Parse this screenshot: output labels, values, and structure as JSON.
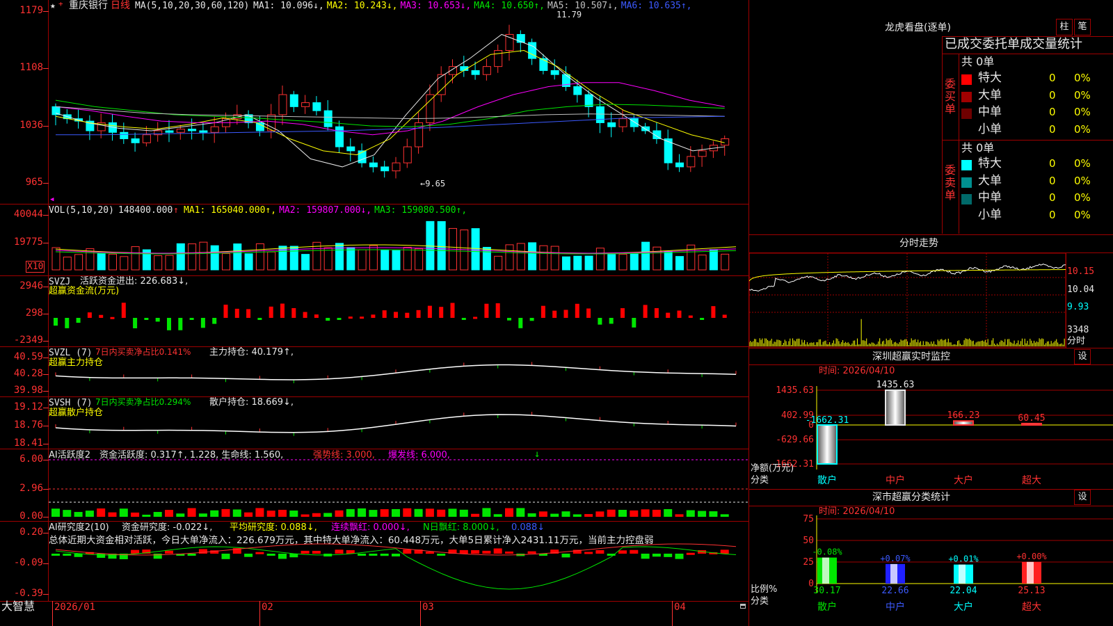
{
  "stock": {
    "name": "重庆银行",
    "period": "日线"
  },
  "main_chart": {
    "ma_label": "MA(5,10,20,30,60,120)",
    "ma_values": [
      {
        "label": "MA1:",
        "value": "10.096",
        "arrow": "↓",
        "color": "#e8e8e8"
      },
      {
        "label": "MA2:",
        "value": "10.243",
        "arrow": "↓",
        "color": "#ffff00"
      },
      {
        "label": "MA3:",
        "value": "10.653",
        "arrow": "↓",
        "color": "#ff00ff"
      },
      {
        "label": "MA4:",
        "value": "10.650",
        "arrow": "↑",
        "color": "#00e600"
      },
      {
        "label": "MA5:",
        "value": "10.507",
        "arrow": "↓",
        "color": "#c0c0c0"
      },
      {
        "label": "MA6:",
        "value": "10.635",
        "arrow": "↑",
        "color": "#3c5aff"
      }
    ],
    "y_ticks": [
      "1179",
      "1108",
      "1036",
      "965"
    ],
    "high_label": "11.79",
    "low_label": "←9.65"
  },
  "volume": {
    "label": "VOL(5,10,20)",
    "value": "148400.000",
    "ma": [
      {
        "label": "MA1:",
        "value": "165040.000",
        "arrow": "↑",
        "color": "#ffff00"
      },
      {
        "label": "MA2:",
        "value": "159807.000",
        "arrow": "↓",
        "color": "#ff00ff"
      },
      {
        "label": "MA3:",
        "value": "159080.500",
        "arrow": "↑",
        "color": "#00e600"
      }
    ],
    "y_ticks": [
      "40044",
      "19775"
    ],
    "unit": "X10"
  },
  "svzj": {
    "label": "SVZJ",
    "line1": "活跃资金进出: 226.683↓,",
    "line2": "超赢资金流(万元)",
    "y_ticks": [
      "2946",
      "298",
      "-2349"
    ]
  },
  "svzl": {
    "label": "SVZL (7)",
    "ratio": "7日内买卖净占比0.141%",
    "hold": "主力持仓: 40.179↑,",
    "line2": "超赢主力持仓",
    "y_ticks": [
      "40.59",
      "40.28",
      "39.98"
    ]
  },
  "svsh": {
    "label": "SVSH (7)",
    "ratio": "7日内买卖净占比0.294%",
    "hold": "散户持仓: 18.669↓,",
    "line2": "超赢散户持仓",
    "y_ticks": [
      "19.12",
      "18.76",
      "18.41"
    ]
  },
  "ai_active": {
    "name": "AI活跃度2",
    "text_a": "资金活跃度: 0.317↑, 1.228, 生命线: 1.560,",
    "strong": "强势线: 3.000,",
    "burst": "爆发线: 6.000,",
    "y_ticks": [
      "6.00",
      "2.96",
      "0.00"
    ]
  },
  "ai_research": {
    "name": "AI研究度2(10)",
    "a": "资金研究度: -0.022↓,",
    "b": "平均研究度: 0.088↓,",
    "c": "连续飘红: 0.000↓,",
    "d": "N日飘红: 8.000↓,",
    "e": "0.088↓",
    "summary": "总体近期大资金相对活跃，今日大单净流入：226.679万元，其中特大单净流入：60.448万元，大单5日累计净入2431.11万元，当前主力控盘弱",
    "y_ticks": [
      "0.20",
      "-0.09",
      "-0.39"
    ]
  },
  "x_axis": {
    "brand": "大智慧",
    "dates": [
      "2026/01",
      "02",
      "03",
      "04"
    ]
  },
  "dragon": {
    "title": "龙虎看盘(逐单)",
    "btn_bar": "柱",
    "btn_pen": "笔",
    "heading": "已成交委托单成交量统计",
    "buy_label": "委买单",
    "sell_label": "委卖单",
    "buy_total": "共 0单",
    "sell_total": "共 0单",
    "buy_rows": [
      {
        "name": "特大",
        "count": "0",
        "pct": "0%",
        "color": "#ff0000"
      },
      {
        "name": "大单",
        "count": "0",
        "pct": "0%",
        "color": "#a00000"
      },
      {
        "name": "中单",
        "count": "0",
        "pct": "0%",
        "color": "#700000"
      },
      {
        "name": "小单",
        "count": "0",
        "pct": "0%",
        "color": "#000000"
      }
    ],
    "sell_rows": [
      {
        "name": "特大",
        "count": "0",
        "pct": "0%",
        "color": "#00ffff"
      },
      {
        "name": "大单",
        "count": "0",
        "pct": "0%",
        "color": "#009090"
      },
      {
        "name": "中单",
        "count": "0",
        "pct": "0%",
        "color": "#006a6a"
      },
      {
        "name": "小单",
        "count": "0",
        "pct": "0%",
        "color": "#000000"
      }
    ]
  },
  "intraday": {
    "title": "分时走势",
    "prices": [
      "10.15",
      "10.04",
      "9.93"
    ],
    "volume": "3348",
    "unit": "分时"
  },
  "sz_monitor": {
    "title": "深圳超赢实时监控",
    "btn": "设",
    "time": "时间: 2026/04/10",
    "y_ticks": [
      "1435.63",
      "402.99",
      "0",
      "-629.66",
      "-1662.31"
    ],
    "ylabel": "净额(万元)",
    "xlabel": "分类",
    "chart_data": {
      "type": "bar",
      "categories": [
        "散户",
        "中户",
        "大户",
        "超大"
      ],
      "values": [
        -1662.31,
        1435.63,
        166.23,
        60.45
      ],
      "value_labels": [
        "-1662.31",
        "1435.63",
        "166.23",
        "60.45"
      ],
      "colors": [
        "#00ffff",
        "#e8e8e8",
        "#ff3232",
        "#ff3232"
      ],
      "ylim": [
        -1662.31,
        1435.63
      ]
    }
  },
  "sz_class": {
    "title": "深市超赢分类统计",
    "btn": "设",
    "time": "时间: 2026/04/10",
    "y_ticks": [
      "75",
      "50",
      "25",
      "0"
    ],
    "ylabel": "比例%",
    "xlabel": "分类",
    "chart_data": {
      "type": "bar",
      "categories": [
        "散户",
        "中户",
        "大户",
        "超大"
      ],
      "values": [
        30.17,
        22.66,
        22.04,
        25.13
      ],
      "value_labels": [
        "30.17",
        "22.66",
        "22.04",
        "25.13"
      ],
      "change_labels": [
        "-0.08%",
        "+0.07%",
        "+0.01%",
        "+0.00%"
      ],
      "bar_colors": [
        "#00e600",
        "#2020ff",
        "#00ffff",
        "#ff2020"
      ],
      "label_colors": [
        "#00e600",
        "#3c5aff",
        "#00ffff",
        "#ff3232"
      ],
      "ylim": [
        0,
        75
      ]
    }
  }
}
